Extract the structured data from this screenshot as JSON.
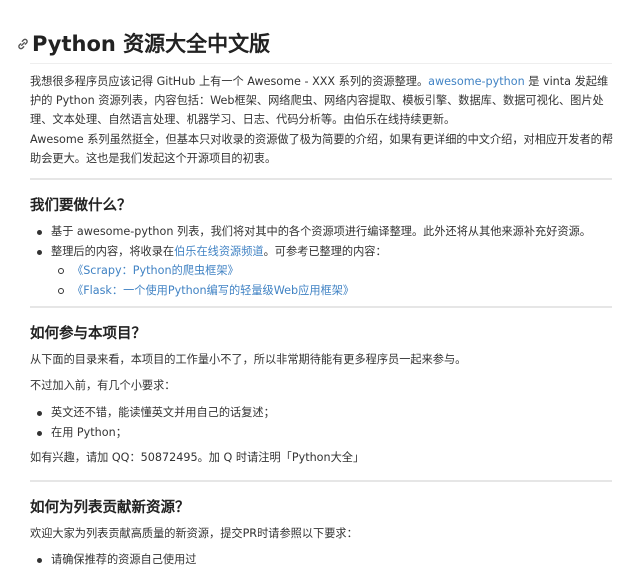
{
  "title": "Python 资源大全中文版",
  "intro": {
    "p1_before": "我想很多程序员应该记得 GitHub 上有一个 Awesome - XXX 系列的资源整理。",
    "p1_link": "awesome-python",
    "p1_after": " 是 vinta 发起维护的 Python 资源列表，内容包括：Web框架、网络爬虫、网络内容提取、模板引擎、数据库、数据可视化、图片处理、文本处理、自然语言处理、机器学习、日志、代码分析等。由伯乐在线持续更新。",
    "p2": "Awesome 系列虽然挺全，但基本只对收录的资源做了极为简要的介绍，如果有更详细的中文介绍，对相应开发者的帮助会更大。这也是我们发起这个开源项目的初衷。"
  },
  "section1": {
    "heading": "我们要做什么？",
    "item1": "基于 awesome-python 列表，我们将对其中的各个资源项进行编译整理。此外还将从其他来源补充好资源。",
    "item2_before": "整理后的内容，将收录在",
    "item2_link": "伯乐在线资源频道",
    "item2_after": "。可参考已整理的内容：",
    "sub_items": [
      "《Scrapy：Python的爬虫框架》",
      "《Flask：一个使用Python编写的轻量级Web应用框架》"
    ]
  },
  "section2": {
    "heading": "如何参与本项目？",
    "p1": "从下面的目录来看，本项目的工作量小不了，所以非常期待能有更多程序员一起来参与。",
    "p2": "不过加入前，有几个小要求：",
    "items": [
      "英文还不错，能读懂英文并用自己的话复述；",
      "在用 Python；"
    ],
    "p3": "如有兴趣，请加 QQ：50872495。加 Q 时请注明「Python大全」"
  },
  "section3": {
    "heading": "如何为列表贡献新资源？",
    "p1": "欢迎大家为列表贡献高质量的新资源，提交PR时请参照以下要求：",
    "items": [
      "请确保推荐的资源自己使用过"
    ]
  },
  "colors": {
    "link": "#4183c4",
    "text": "#333333",
    "heading": "#222222",
    "rule": "#e6e6e6"
  }
}
